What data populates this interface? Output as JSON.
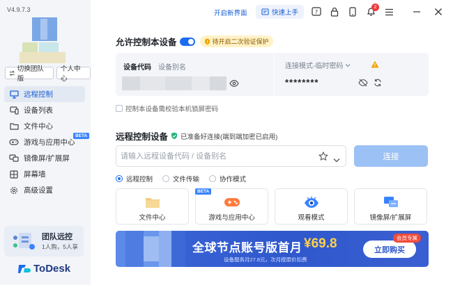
{
  "app": {
    "version": "V4.9.7.3",
    "logo_text": "ToDesk"
  },
  "sidebar": {
    "switch_team_label": "切换团队版",
    "personal_center_label": "个人中心",
    "items": [
      {
        "label": "远程控制",
        "icon": "monitor-icon",
        "active": true
      },
      {
        "label": "设备列表",
        "icon": "device-list-icon"
      },
      {
        "label": "文件中心",
        "icon": "folder-icon"
      },
      {
        "label": "游戏与应用中心",
        "icon": "gamepad-icon",
        "badge": "BETA"
      },
      {
        "label": "镜像屏/扩展屏",
        "icon": "mirror-screen-icon"
      },
      {
        "label": "屏幕墙",
        "icon": "screen-wall-icon"
      },
      {
        "label": "高级设置",
        "icon": "gear-icon"
      }
    ],
    "team": {
      "title": "团队远控",
      "subtitle": "1人购，5人享"
    }
  },
  "topbar": {
    "new_ui_label": "开启新界面",
    "quick_start_label": "快速上手",
    "notification_count": "2"
  },
  "allow": {
    "title": "允许控制本设备",
    "warning": "待开启二次验证保护"
  },
  "device": {
    "code_label": "设备代码",
    "alias_label": "设备别名",
    "mode_label": "连接模式-临时密码",
    "password": "********"
  },
  "lockscreen_option": "控制本设备需校验本机锁屏密码",
  "remote": {
    "title": "远程控制设备",
    "status_note": "已准备好连接(端到端加密已启用)",
    "search_placeholder": "请输入远程设备代码 / 设备别名",
    "connect_label": "连接",
    "modes": [
      {
        "label": "远程控制",
        "selected": true
      },
      {
        "label": "文件传输",
        "selected": false
      },
      {
        "label": "协作模式",
        "selected": false
      }
    ]
  },
  "tiles": [
    {
      "label": "文件中心",
      "icon": "folder-icon"
    },
    {
      "label": "游戏与应用中心",
      "icon": "gamepad-icon",
      "badge": "BETA"
    },
    {
      "label": "观看模式",
      "icon": "eye-icon"
    },
    {
      "label": "镜像屏/扩展屏",
      "icon": "mirror-screen-icon"
    }
  ],
  "banner": {
    "title": "全球节点账号版首月",
    "price": "¥69.8",
    "subtitle": "设备服务月27.8元，次月按原价扣费",
    "buy_label": "立即购买",
    "vip_label": "会员专属"
  },
  "colors": {
    "accent": "#1a6cf0",
    "sidebar_bg": "#f3f5f9",
    "connect_disabled": "#9cc1f5",
    "banner_bg": "#2f58cc",
    "price": "#ffd24a"
  }
}
